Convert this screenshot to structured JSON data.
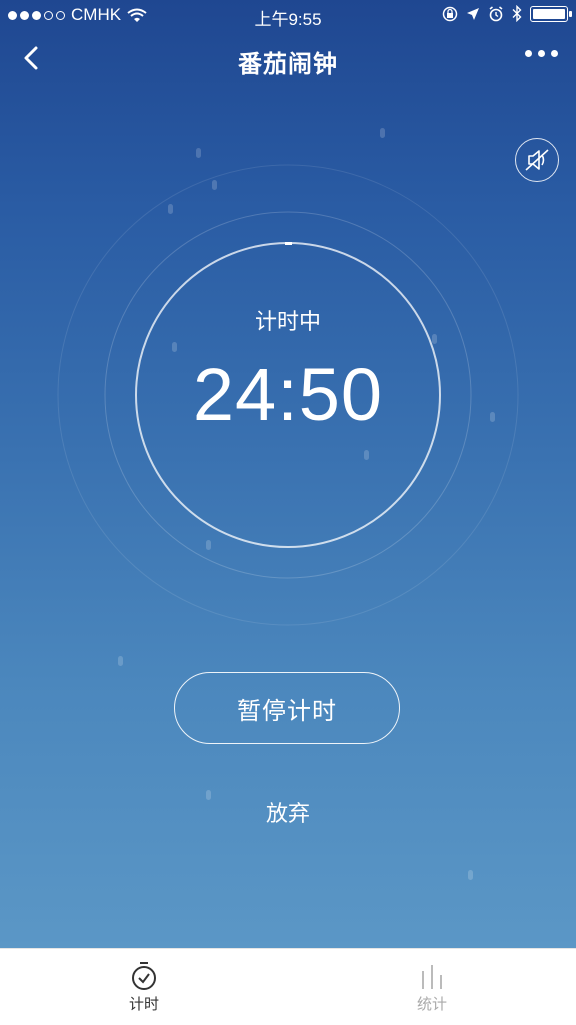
{
  "status_bar": {
    "carrier": "CMHK",
    "time": "上午9:55",
    "battery_level": 1.0
  },
  "nav": {
    "title": "番茄闹钟"
  },
  "timer": {
    "state": "计时中",
    "time": "24:50"
  },
  "actions": {
    "pause_label": "暂停计时",
    "give_up_label": "放弃"
  },
  "tabs": [
    {
      "label": "计时",
      "icon": "stopwatch-icon",
      "active": true
    },
    {
      "label": "统计",
      "icon": "bar-chart-icon",
      "active": false
    }
  ],
  "colors": {
    "background_top": "#1f4791",
    "background_bottom": "#5b97c6",
    "tab_active": "#333333",
    "tab_inactive": "#aaaaaa"
  }
}
